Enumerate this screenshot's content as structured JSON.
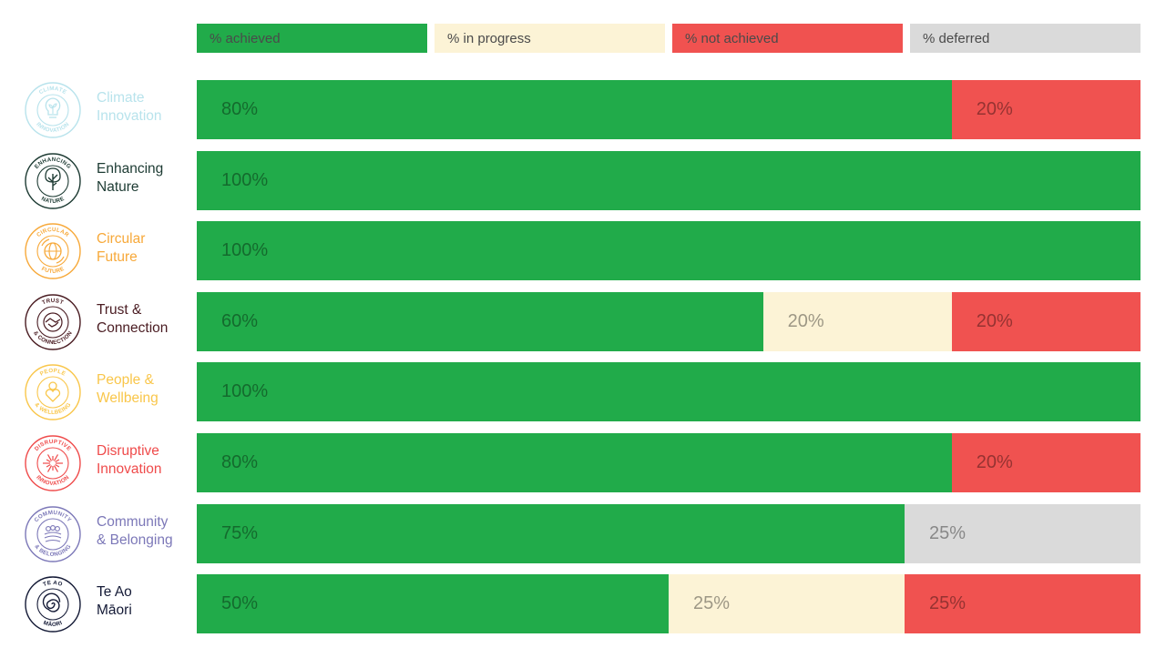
{
  "colors": {
    "achieved": "#21ab4a",
    "in_progress": "#fcf3d6",
    "not_achieved": "#f05250",
    "deferred": "#dadada"
  },
  "legend": [
    {
      "key": "achieved",
      "label": "% achieved"
    },
    {
      "key": "in_progress",
      "label": "% in progress"
    },
    {
      "key": "not_achieved",
      "label": "% not achieved"
    },
    {
      "key": "deferred",
      "label": "% deferred"
    }
  ],
  "chart_data": {
    "type": "bar",
    "orientation": "horizontal",
    "stacked": true,
    "normalized": "100%",
    "categories": [
      "Climate Innovation",
      "Enhancing Nature",
      "Circular Future",
      "Trust & Connection",
      "People & Wellbeing",
      "Disruptive Innovation",
      "Community & Belonging",
      "Te Ao Māori"
    ],
    "series": [
      {
        "name": "% achieved",
        "key": "achieved",
        "values": [
          80,
          100,
          100,
          60,
          100,
          80,
          75,
          50
        ]
      },
      {
        "name": "% in progress",
        "key": "in_progress",
        "values": [
          0,
          0,
          0,
          20,
          0,
          0,
          0,
          25
        ]
      },
      {
        "name": "% not achieved",
        "key": "not_achieved",
        "values": [
          20,
          0,
          0,
          20,
          0,
          20,
          0,
          25
        ]
      },
      {
        "name": "% deferred",
        "key": "deferred",
        "values": [
          0,
          0,
          0,
          0,
          0,
          0,
          25,
          0
        ]
      }
    ],
    "legend_position": "top",
    "grid": false
  },
  "rows": [
    {
      "label": "Climate\nInnovation",
      "color": "#b8e3ec",
      "icon": "lightbulb-plant-icon",
      "badge_top": "CLIMATE",
      "badge_bottom": "INNOVATION"
    },
    {
      "label": "Enhancing\nNature",
      "color": "#1d3b33",
      "icon": "tree-icon",
      "badge_top": "ENHANCING",
      "badge_bottom": "NATURE"
    },
    {
      "label": "Circular\nFuture",
      "color": "#f7a93a",
      "icon": "globe-arrows-icon",
      "badge_top": "CIRCULAR",
      "badge_bottom": "FUTURE"
    },
    {
      "label": "Trust &\nConnection",
      "color": "#4a1c22",
      "icon": "handshake-icon",
      "badge_top": "TRUST",
      "badge_bottom": "& CONNECTION"
    },
    {
      "label": "People &\nWellbeing",
      "color": "#f9c64a",
      "icon": "person-heart-icon",
      "badge_top": "PEOPLE",
      "badge_bottom": "& WELLBEING"
    },
    {
      "label": "Disruptive\nInnovation",
      "color": "#ef4b4b",
      "icon": "starburst-icon",
      "badge_top": "DISRUPTIVE",
      "badge_bottom": "INNOVATION"
    },
    {
      "label": "Community\n& Belonging",
      "color": "#7c78b8",
      "icon": "people-group-icon",
      "badge_top": "COMMUNITY",
      "badge_bottom": "& BELONGING"
    },
    {
      "label": "Te Ao\nMāori",
      "color": "#141a36",
      "icon": "koru-spiral-icon",
      "badge_top": "TE AO",
      "badge_bottom": "MĀORI"
    }
  ]
}
